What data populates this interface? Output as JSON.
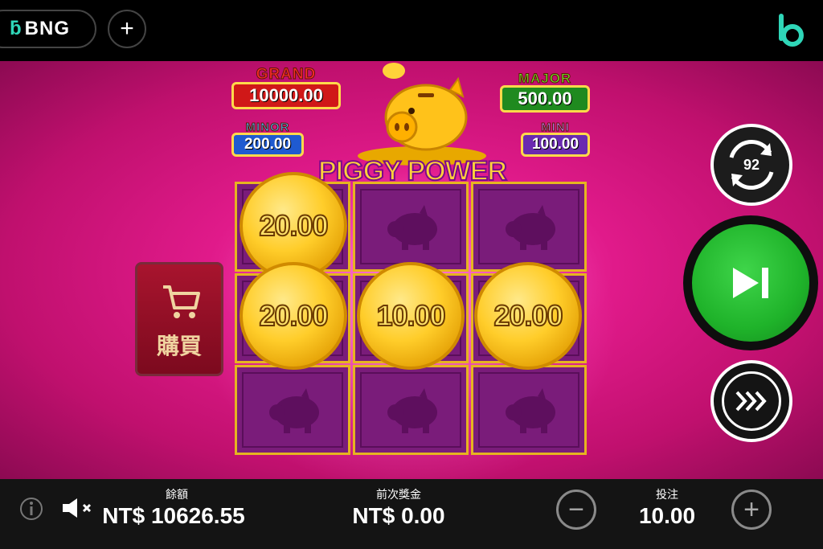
{
  "topbar": {
    "brand_text": "BNG",
    "plus_label": "+"
  },
  "jackpots": {
    "grand": {
      "label": "GRAND",
      "value": "10000.00"
    },
    "major": {
      "label": "MAJOR",
      "value": "500.00"
    },
    "minor": {
      "label": "MINOR",
      "value": "200.00"
    },
    "mini": {
      "label": "MINI",
      "value": "100.00"
    }
  },
  "game_logo": "PIGGY POWER",
  "grid": {
    "coins": [
      "20.00",
      "20.00",
      "10.00",
      "20.00"
    ]
  },
  "buy_feature": {
    "label": "購買"
  },
  "controls": {
    "autoplay_count": "92"
  },
  "bottom": {
    "balance_label": "餘額",
    "balance_value": "NT$ 10626.55",
    "last_win_label": "前次獎金",
    "last_win_value": "NT$ 0.00",
    "bet_label": "投注",
    "bet_value": "10.00",
    "minus": "−",
    "plus": "+"
  },
  "colors": {
    "accent_green": "#1fb32a",
    "stage_pink": "#e01a8a",
    "coin_gold": "#ffcd2a"
  }
}
